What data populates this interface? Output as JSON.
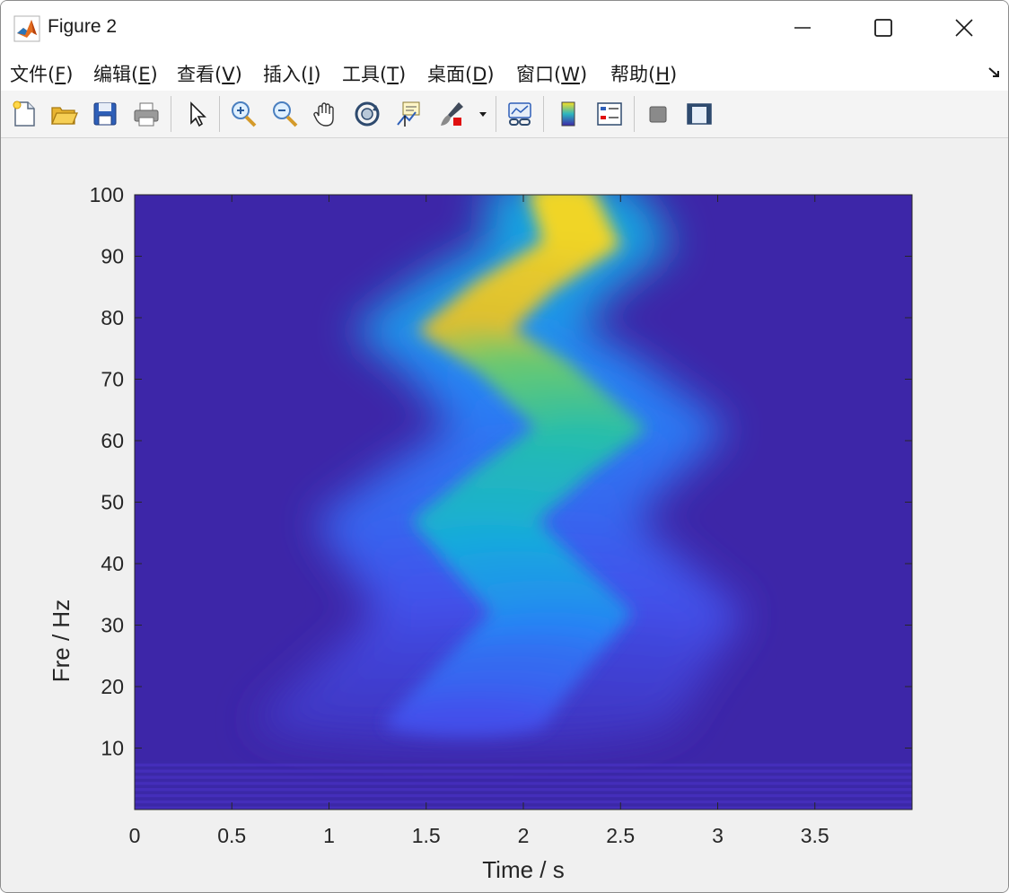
{
  "window": {
    "title": "Figure 2",
    "icon": "matlab-logo-icon",
    "controls": [
      "minimize-icon",
      "maximize-icon",
      "close-icon"
    ]
  },
  "menu": {
    "items": [
      {
        "label": "文件(",
        "key": "F",
        "suffix": ")"
      },
      {
        "label": "编辑(",
        "key": "E",
        "suffix": ")"
      },
      {
        "label": "查看(",
        "key": "V",
        "suffix": ")"
      },
      {
        "label": "插入(",
        "key": "I",
        "suffix": ")"
      },
      {
        "label": "工具(",
        "key": "T",
        "suffix": ")"
      },
      {
        "label": "桌面(",
        "key": "D",
        "suffix": ")"
      },
      {
        "label": "窗口(",
        "key": "W",
        "suffix": ")"
      },
      {
        "label": "帮助(",
        "key": "H",
        "suffix": ")"
      }
    ]
  },
  "toolbar": {
    "icons": [
      "new-figure-icon",
      "open-file-icon",
      "save-icon",
      "print-icon",
      "pointer-icon",
      "zoom-in-icon",
      "zoom-out-icon",
      "pan-hand-icon",
      "rotate-3d-icon",
      "data-cursor-icon",
      "brush-icon",
      "link-plot-icon",
      "colorbar-icon",
      "legend-icon",
      "hide-plot-tools-icon",
      "show-plot-tools-icon"
    ]
  },
  "colors": {
    "background_parula": "#3d26a8",
    "ridge_peak": "#f9e021",
    "figure_bg": "#f0f0f0"
  },
  "chart_data": {
    "type": "heatmap",
    "colormap": "parula",
    "xlabel": "Time / s",
    "ylabel": "Fre / Hz",
    "xlim": [
      0,
      4
    ],
    "ylim": [
      0,
      100
    ],
    "xticks": [
      0,
      0.5,
      1,
      1.5,
      2,
      2.5,
      3,
      3.5
    ],
    "xtick_labels": [
      "0",
      "0.5",
      "1",
      "1.5",
      "2",
      "2.5",
      "3",
      "3.5"
    ],
    "yticks": [
      10,
      20,
      30,
      40,
      50,
      60,
      70,
      80,
      90,
      100
    ],
    "ytick_labels": [
      "10",
      "20",
      "30",
      "40",
      "50",
      "60",
      "70",
      "80",
      "90",
      "100"
    ],
    "ridge": {
      "frequency_hz": [
        100,
        92,
        85,
        78,
        72,
        62,
        55,
        47,
        40,
        32,
        25,
        18,
        14
      ],
      "time_s": [
        2.2,
        2.3,
        1.95,
        1.7,
        2.0,
        2.35,
        2.05,
        1.75,
        1.95,
        2.2,
        2.0,
        1.8,
        1.7
      ],
      "intensity": [
        0.95,
        0.95,
        0.88,
        0.85,
        0.72,
        0.62,
        0.55,
        0.5,
        0.42,
        0.35,
        0.25,
        0.2,
        0.15
      ]
    },
    "grid": false
  }
}
